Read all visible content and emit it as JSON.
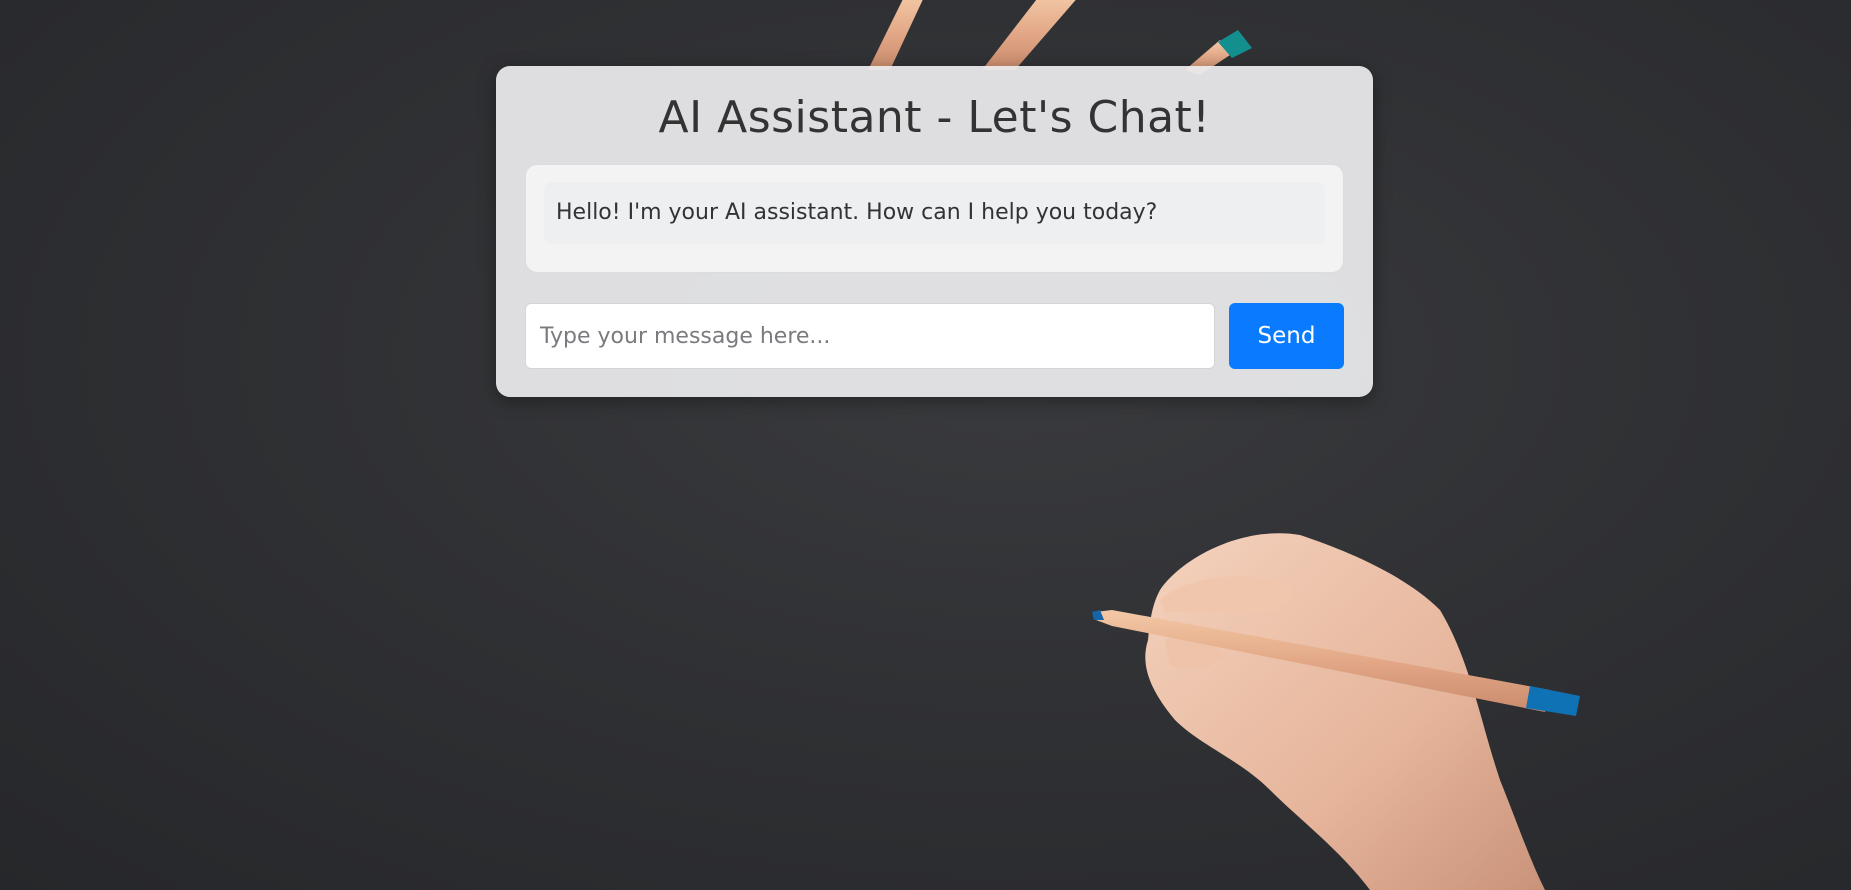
{
  "colors": {
    "background": "#2f3033",
    "card": "#ececee",
    "accent": "#0a7bff"
  },
  "background_image": {
    "semantic": "hand holding colored pencil on dark paper, with pencils at top"
  },
  "chat": {
    "title": "AI Assistant - Let's Chat!",
    "messages": [
      {
        "sender": "assistant",
        "text": "Hello! I'm your AI assistant. How can I help you today?"
      }
    ],
    "input": {
      "placeholder": "Type your message here...",
      "value": ""
    },
    "send_label": "Send"
  }
}
